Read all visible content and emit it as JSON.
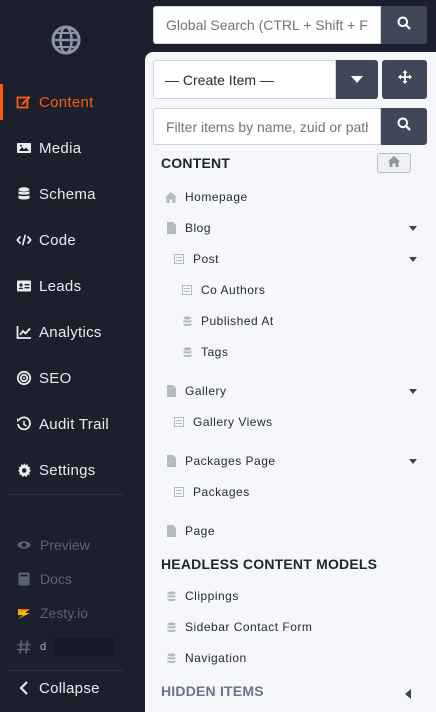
{
  "nav": {
    "items": [
      {
        "label": "Content",
        "icon": "edit-icon",
        "active": true
      },
      {
        "label": "Media",
        "icon": "image-icon"
      },
      {
        "label": "Schema",
        "icon": "database-icon"
      },
      {
        "label": "Code",
        "icon": "code-icon"
      },
      {
        "label": "Leads",
        "icon": "id-card-icon"
      },
      {
        "label": "Analytics",
        "icon": "line-chart-icon"
      },
      {
        "label": "SEO",
        "icon": "target-icon"
      },
      {
        "label": "Audit Trail",
        "icon": "history-icon"
      },
      {
        "label": "Settings",
        "icon": "gear-icon"
      }
    ],
    "sub": [
      {
        "label": "Preview",
        "icon": "eye-icon"
      },
      {
        "label": "Docs",
        "icon": "book-icon"
      },
      {
        "label": "Zesty.io",
        "icon": "zesty-icon"
      },
      {
        "label": "d",
        "icon": "hash-icon"
      }
    ],
    "collapse_label": "Collapse"
  },
  "search": {
    "placeholder": "Global Search (CTRL + Shift + F)"
  },
  "content_panel": {
    "create_label": "— Create Item —",
    "filter_placeholder": "Filter items by name, zuid or path",
    "content_title": "CONTENT",
    "headless_title": "HEADLESS CONTENT MODELS",
    "hidden_title": "HIDDEN ITEMS",
    "tree": [
      {
        "label": "Homepage"
      },
      {
        "label": "Blog"
      },
      {
        "label": "Post"
      },
      {
        "label": "Co Authors"
      },
      {
        "label": "Published At"
      },
      {
        "label": "Tags"
      },
      {
        "label": "Gallery"
      },
      {
        "label": "Gallery Views"
      },
      {
        "label": "Packages Page"
      },
      {
        "label": "Packages"
      },
      {
        "label": "Page"
      }
    ],
    "headless": [
      {
        "label": "Clippings"
      },
      {
        "label": "Sidebar Contact Form"
      },
      {
        "label": "Navigation"
      }
    ]
  },
  "colors": {
    "accent": "#ff5c0a",
    "nav_bg": "#1b202c",
    "panel_bg": "#f5f7fb",
    "button_bg": "#404759"
  }
}
